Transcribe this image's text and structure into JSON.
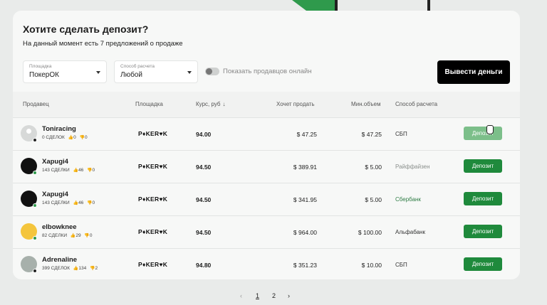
{
  "header": {
    "title": "Хотите сделать депозит?",
    "subtitle": "На данный момент есть 7 предложений о продаже"
  },
  "filters": {
    "platform_label": "Площадка",
    "platform_value": "ПокерОК",
    "method_label": "Способ расчета",
    "method_value": "Любой",
    "online_toggle_label": "Показать продавцов онлайн",
    "online_toggle_on": false
  },
  "withdraw_button": "Вывести деньги",
  "columns": {
    "seller": "Продавец",
    "platform": "Площадка",
    "rate": "Курс, руб",
    "wants": "Хочет продать",
    "min": "Мин.объем",
    "method": "Способ расчета"
  },
  "rows": [
    {
      "name": "Toniracing",
      "deals": "0 СДЕЛОК",
      "likes": "0",
      "dislikes": "0",
      "platform": "P♦KER♥K",
      "rate": "94.00",
      "wants": "$ 47.25",
      "min": "$ 47.25",
      "method": "СБП",
      "online": false,
      "button": "Депозит"
    },
    {
      "name": "Xapugi4",
      "deals": "143 СДЕЛКИ",
      "likes": "46",
      "dislikes": "0",
      "platform": "P♦KER♥K",
      "rate": "94.50",
      "wants": "$ 389.91",
      "min": "$ 5.00",
      "method": "Райффайзен",
      "online": true,
      "button": "Депозит"
    },
    {
      "name": "Xapugi4",
      "deals": "143 СДЕЛКИ",
      "likes": "46",
      "dislikes": "0",
      "platform": "P♦KER♥K",
      "rate": "94.50",
      "wants": "$ 341.95",
      "min": "$ 5.00",
      "method": "Сбербанк",
      "online": true,
      "button": "Депозит"
    },
    {
      "name": "elbowknee",
      "deals": "82 СДЕЛКИ",
      "likes": "29",
      "dislikes": "0",
      "platform": "P♦KER♥K",
      "rate": "94.50",
      "wants": "$ 964.00",
      "min": "$ 100.00",
      "method": "Альфабанк",
      "online": true,
      "button": "Депозит"
    },
    {
      "name": "Adrenaline",
      "deals": "399 СДЕЛОК",
      "likes": "134",
      "dislikes": "2",
      "platform": "P♦KER♥K",
      "rate": "94.80",
      "wants": "$ 351.23",
      "min": "$ 10.00",
      "method": "СБП",
      "online": false,
      "button": "Депозит"
    }
  ],
  "pagination": {
    "prev": "‹",
    "pages": [
      "1",
      "2"
    ],
    "next": "›",
    "current": "1"
  },
  "colors": {
    "accent": "#1f8a3c",
    "accent_hover": "#7cbf8a",
    "primary_button": "#000000"
  }
}
